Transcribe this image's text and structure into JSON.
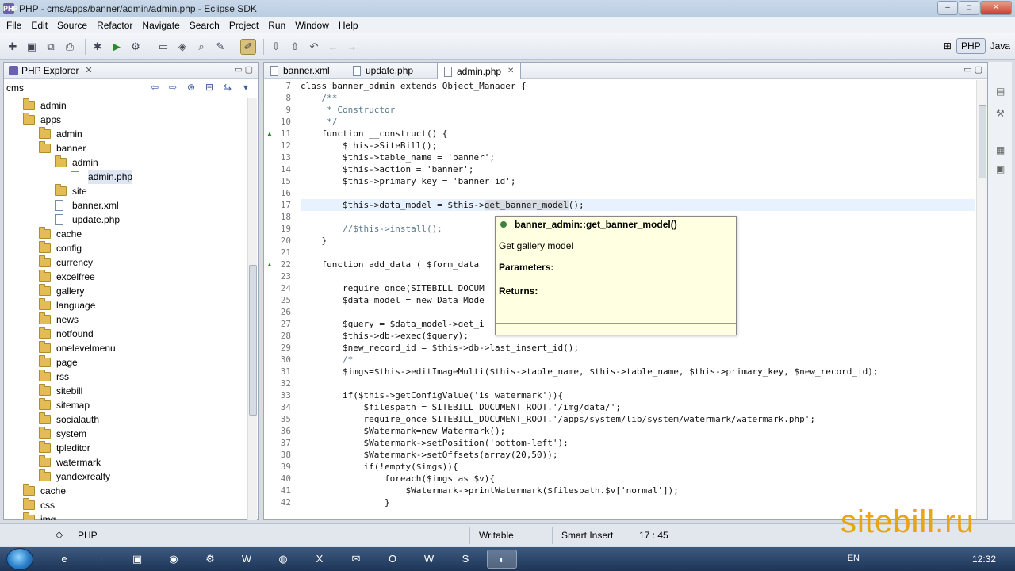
{
  "window": {
    "title": "PHP - cms/apps/banner/admin/admin.php - Eclipse SDK",
    "app_icon": "PHP",
    "min": "–",
    "max": "□",
    "close": "✕"
  },
  "menu": [
    "File",
    "Edit",
    "Source",
    "Refactor",
    "Navigate",
    "Search",
    "Project",
    "Run",
    "Window",
    "Help"
  ],
  "perspectives": {
    "php": "PHP",
    "java": "Java"
  },
  "explorer": {
    "title": "PHP Explorer",
    "root": "cms",
    "items": [
      {
        "label": "admin",
        "type": "folder",
        "depth": 0
      },
      {
        "label": "apps",
        "type": "folder",
        "depth": 0
      },
      {
        "label": "admin",
        "type": "folder",
        "depth": 1
      },
      {
        "label": "banner",
        "type": "folder",
        "depth": 1
      },
      {
        "label": "admin",
        "type": "folder",
        "depth": 2
      },
      {
        "label": "admin.php",
        "type": "file",
        "depth": 3
      },
      {
        "label": "site",
        "type": "folder",
        "depth": 2
      },
      {
        "label": "banner.xml",
        "type": "file",
        "depth": 2
      },
      {
        "label": "update.php",
        "type": "file",
        "depth": 2
      },
      {
        "label": "cache",
        "type": "folder",
        "depth": 1
      },
      {
        "label": "config",
        "type": "folder",
        "depth": 1
      },
      {
        "label": "currency",
        "type": "folder",
        "depth": 1
      },
      {
        "label": "excelfree",
        "type": "folder",
        "depth": 1
      },
      {
        "label": "gallery",
        "type": "folder",
        "depth": 1
      },
      {
        "label": "language",
        "type": "folder",
        "depth": 1
      },
      {
        "label": "news",
        "type": "folder",
        "depth": 1
      },
      {
        "label": "notfound",
        "type": "folder",
        "depth": 1
      },
      {
        "label": "onelevelmenu",
        "type": "folder",
        "depth": 1
      },
      {
        "label": "page",
        "type": "folder",
        "depth": 1
      },
      {
        "label": "rss",
        "type": "folder",
        "depth": 1
      },
      {
        "label": "sitebill",
        "type": "folder",
        "depth": 1
      },
      {
        "label": "sitemap",
        "type": "folder",
        "depth": 1
      },
      {
        "label": "socialauth",
        "type": "folder",
        "depth": 1
      },
      {
        "label": "system",
        "type": "folder",
        "depth": 1
      },
      {
        "label": "tpleditor",
        "type": "folder",
        "depth": 1
      },
      {
        "label": "watermark",
        "type": "folder",
        "depth": 1
      },
      {
        "label": "yandexrealty",
        "type": "folder",
        "depth": 1
      },
      {
        "label": "cache",
        "type": "folder",
        "depth": 0
      },
      {
        "label": "css",
        "type": "folder",
        "depth": 0
      },
      {
        "label": "img",
        "type": "folder",
        "depth": 0
      }
    ]
  },
  "editor": {
    "tabs": [
      {
        "label": "banner.xml",
        "active": false
      },
      {
        "label": "update.php",
        "active": false
      },
      {
        "label": "admin.php",
        "active": true
      }
    ],
    "lines": [
      {
        "n": "7",
        "text": "class banner_admin extends Object_Manager {"
      },
      {
        "n": "8",
        "text": "    /**"
      },
      {
        "n": "9",
        "text": "     * Constructor"
      },
      {
        "n": "10",
        "text": "     */"
      },
      {
        "n": "11",
        "text": "    function __construct() {"
      },
      {
        "n": "12",
        "text": "        $this->SiteBill();"
      },
      {
        "n": "13",
        "text": "        $this->table_name = 'banner';"
      },
      {
        "n": "14",
        "text": "        $this->action = 'banner';"
      },
      {
        "n": "15",
        "text": "        $this->primary_key = 'banner_id';"
      },
      {
        "n": "16",
        "text": ""
      },
      {
        "n": "17",
        "text": "        $this->data_model = $this->get_banner_model();"
      },
      {
        "n": "18",
        "text": ""
      },
      {
        "n": "19",
        "text": "        //$this->install();"
      },
      {
        "n": "20",
        "text": "    }"
      },
      {
        "n": "21",
        "text": ""
      },
      {
        "n": "22",
        "text": "    function add_data ( $form_data"
      },
      {
        "n": "23",
        "text": ""
      },
      {
        "n": "24",
        "text": "        require_once(SITEBILL_DOCUM                                    ;"
      },
      {
        "n": "25",
        "text": "        $data_model = new Data_Mode"
      },
      {
        "n": "26",
        "text": ""
      },
      {
        "n": "27",
        "text": "        $query = $data_model->get_i                                    $form_data);"
      },
      {
        "n": "28",
        "text": "        $this->db->exec($query);"
      },
      {
        "n": "29",
        "text": "        $new_record_id = $this->db->last_insert_id();"
      },
      {
        "n": "30",
        "text": "        /*"
      },
      {
        "n": "31",
        "text": "        $imgs=$this->editImageMulti($this->table_name, $this->table_name, $this->primary_key, $new_record_id);"
      },
      {
        "n": "32",
        "text": ""
      },
      {
        "n": "33",
        "text": "        if($this->getConfigValue('is_watermark')){"
      },
      {
        "n": "34",
        "text": "            $filespath = SITEBILL_DOCUMENT_ROOT.'/img/data/';"
      },
      {
        "n": "35",
        "text": "            require_once SITEBILL_DOCUMENT_ROOT.'/apps/system/lib/system/watermark/watermark.php';"
      },
      {
        "n": "36",
        "text": "            $Watermark=new Watermark();"
      },
      {
        "n": "37",
        "text": "            $Watermark->setPosition('bottom-left');"
      },
      {
        "n": "38",
        "text": "            $Watermark->setOffsets(array(20,50));"
      },
      {
        "n": "39",
        "text": "            if(!empty($imgs)){"
      },
      {
        "n": "40",
        "text": "                foreach($imgs as $v){"
      },
      {
        "n": "41",
        "text": "                    $Watermark->printWatermark($filespath.$v['normal']);"
      },
      {
        "n": "42",
        "text": "                }"
      }
    ]
  },
  "tooltip": {
    "title": "banner_admin::get_banner_model()",
    "description": "Get gallery model",
    "parameters": "Parameters:",
    "returns": "Returns:"
  },
  "status": {
    "file_type": "PHP",
    "mode": "Writable",
    "insert": "Smart Insert",
    "position": "17 : 45"
  },
  "watermark": "sitebill.ru",
  "taskbar": {
    "lang": "EN",
    "time": "12:32"
  },
  "colors": {
    "accent": "#3a6ea5",
    "tooltip_bg": "#ffffe1",
    "folder": "#e4bc55"
  }
}
